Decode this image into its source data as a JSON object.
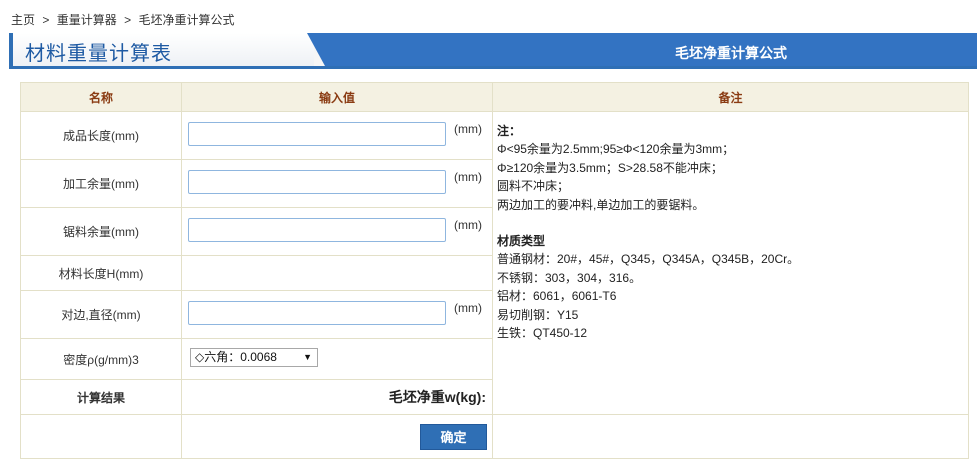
{
  "breadcrumb": {
    "home": "主页",
    "sep1": ">",
    "calc": "重量计算器",
    "sep2": ">",
    "current": "毛坯净重计算公式"
  },
  "header": {
    "title": "材料重量计算表",
    "tab": "毛坯净重计算公式"
  },
  "table": {
    "headers": {
      "name": "名称",
      "input": "输入值",
      "remark": "备注"
    },
    "rows": {
      "product_length": {
        "label": "成品长度(mm)",
        "value": "",
        "unit": "(mm)"
      },
      "machining_allowance": {
        "label": "加工余量(mm)",
        "value": "",
        "unit": "(mm)"
      },
      "saw_allowance": {
        "label": "锯料余量(mm)",
        "value": "",
        "unit": "(mm)"
      },
      "material_length": {
        "label": "材料长度H(mm)"
      },
      "across_flats": {
        "label": "对边,直径(mm)",
        "value": "",
        "unit": "(mm)"
      },
      "density": {
        "label": "密度ρ(g/mm)3",
        "selected": "◇六角：0.0068"
      },
      "result": {
        "label": "计算结果",
        "output_label": "毛坯净重w(kg):"
      }
    },
    "confirm_button": "确定",
    "notes": {
      "title": "注：",
      "lines": [
        "Φ<95余量为2.5mm;95≥Φ<120余量为3mm；",
        "Φ≥120余量为3.5mm；S>28.58不能冲床；",
        "圆料不冲床；",
        "两边加工的要冲料,单边加工的要锯料。"
      ],
      "materials_title": "材质类型",
      "materials": [
        "普通钢材：20#，45#，Q345，Q345A，Q345B，20Cr。",
        "不锈钢：303，304，316。",
        "铝材：6061，6061-T6",
        "易切削钢：Y15",
        "生铁：QT450-12"
      ]
    }
  },
  "colors": {
    "accent": "#2f6fb5",
    "header_text": "#8a3b12",
    "header_bg": "#f4f1e2",
    "border": "#e3e0c8"
  }
}
